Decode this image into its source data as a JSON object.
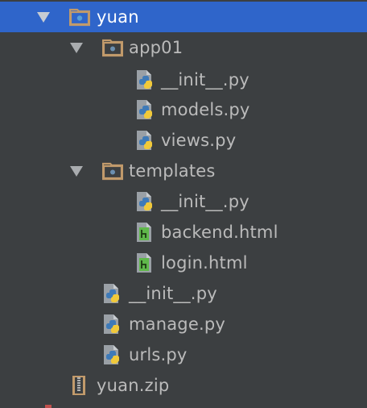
{
  "tree": {
    "root": {
      "label": "yuan",
      "icon": "module-folder-icon",
      "expanded": true
    },
    "app01": {
      "label": "app01",
      "icon": "package-folder-icon",
      "expanded": true,
      "files": [
        "__init__.py",
        "models.py",
        "views.py"
      ]
    },
    "templates": {
      "label": "templates",
      "icon": "package-folder-icon",
      "expanded": true,
      "files": [
        "__init__.py",
        "backend.html",
        "login.html"
      ]
    },
    "root_files": [
      "__init__.py",
      "manage.py",
      "urls.py"
    ],
    "archive": {
      "label": "yuan.zip",
      "icon": "zip-archive-icon"
    }
  },
  "colors": {
    "background": "#3c3f41",
    "selection": "#2f65ca",
    "text": "#bbbbbb",
    "folder": "#c19a6b",
    "python_blue": "#3e7ab8",
    "python_yellow": "#f0c93a",
    "html_green": "#5fb84a"
  }
}
